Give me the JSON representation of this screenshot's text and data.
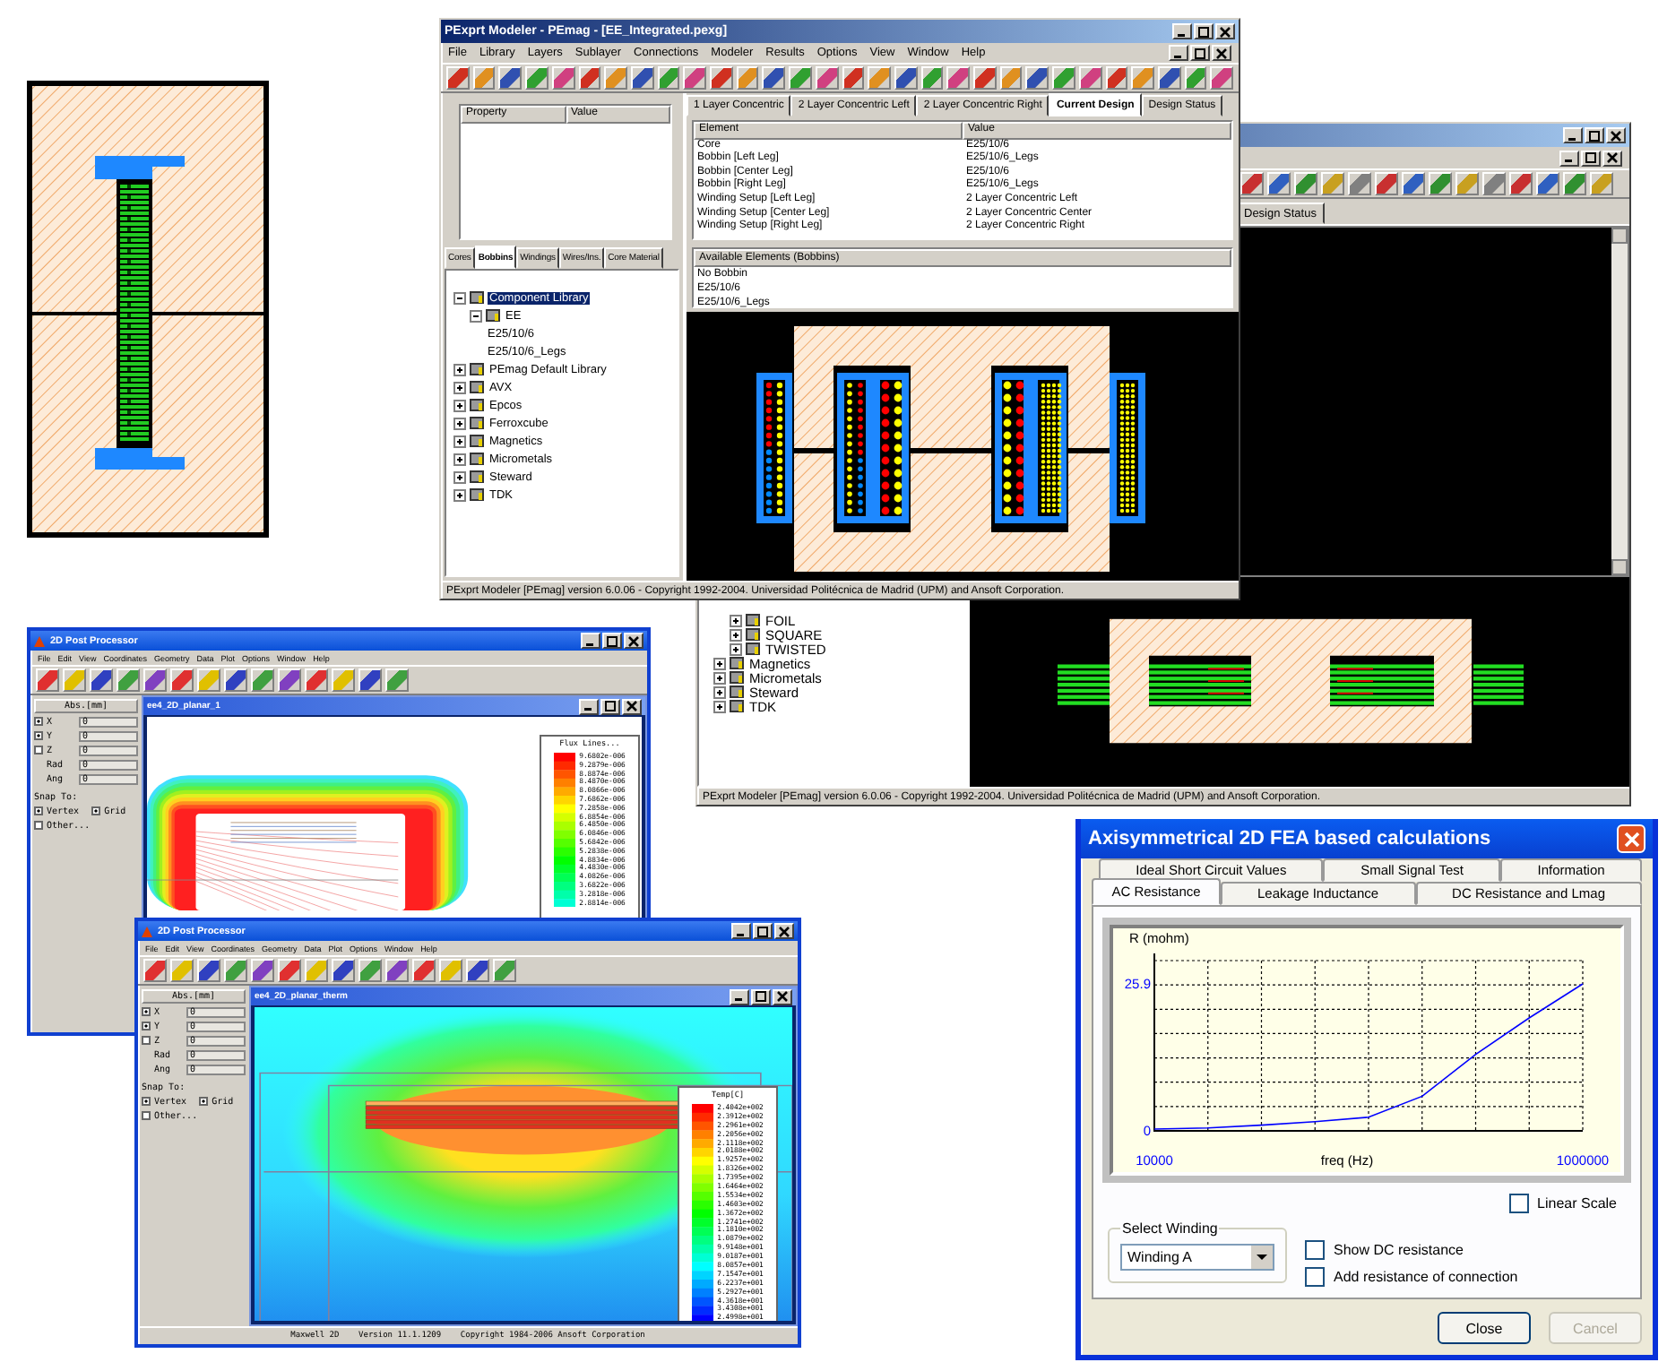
{
  "back_window": {
    "tabs": [
      {
        "label": "Design Status",
        "selected": false
      }
    ],
    "tree": [
      {
        "children": [
          {
            "label": "FOIL",
            "expanded": false,
            "selected": false
          },
          {
            "label": "SQUARE",
            "expanded": false,
            "selected": false
          },
          {
            "label": "TWISTED",
            "expanded": false,
            "selected": false
          }
        ]
      },
      {
        "label": "Magnetics",
        "expanded": false,
        "selected": false
      },
      {
        "label": "Micrometals",
        "expanded": false,
        "selected": false
      },
      {
        "label": "Steward",
        "expanded": false,
        "selected": false
      },
      {
        "label": "TDK",
        "expanded": false,
        "selected": false
      }
    ],
    "status_bar": "PExprt Modeler [PEmag] version 6.0.06 - Copyright 1992-2004. Universidad Politécnica de Madrid (UPM) and Ansoft Corporation."
  },
  "main_window": {
    "title": "PExprt Modeler - PEmag - [EE_Integrated.pexg]",
    "menu": [
      "File",
      "Library",
      "Layers",
      "Sublayer",
      "Connections",
      "Modeler",
      "Results",
      "Options",
      "View",
      "Window",
      "Help"
    ],
    "property_table": {
      "columns": [
        "Property",
        "Value"
      ]
    },
    "library_tabs": [
      {
        "label": "Cores",
        "selected": false
      },
      {
        "label": "Bobbins",
        "selected": true
      },
      {
        "label": "Windings",
        "selected": false
      },
      {
        "label": "Wires/Ins.",
        "selected": false
      },
      {
        "label": "Core Material",
        "selected": false
      }
    ],
    "tree": [
      {
        "label": "Component Library",
        "expanded": true,
        "selected": true,
        "children": [
          {
            "label": "EE",
            "expanded": true,
            "selected": false,
            "children": [
              {
                "label": "E25/10/6",
                "selected": false
              },
              {
                "label": "E25/10/6_Legs",
                "selected": false
              }
            ]
          }
        ]
      },
      {
        "label": "PEmag Default Library",
        "expanded": false,
        "selected": false
      },
      {
        "label": "AVX",
        "expanded": false,
        "selected": false
      },
      {
        "label": "Epcos",
        "expanded": false,
        "selected": false
      },
      {
        "label": "Ferroxcube",
        "expanded": false,
        "selected": false
      },
      {
        "label": "Magnetics",
        "expanded": false,
        "selected": false
      },
      {
        "label": "Micrometals",
        "expanded": false,
        "selected": false
      },
      {
        "label": "Steward",
        "expanded": false,
        "selected": false
      },
      {
        "label": "TDK",
        "expanded": false,
        "selected": false
      }
    ],
    "design_tabs": [
      {
        "label": "1 Layer Concentric",
        "selected": false
      },
      {
        "label": "2 Layer Concentric Left",
        "selected": false
      },
      {
        "label": "2 Layer Concentric Right",
        "selected": false
      },
      {
        "label": "Current Design",
        "selected": true
      },
      {
        "label": "Design Status",
        "selected": false
      }
    ],
    "element_table": {
      "columns": [
        "Element",
        "Value"
      ],
      "rows": [
        [
          "Core",
          "E25/10/6"
        ],
        [
          "Bobbin [Left Leg]",
          "E25/10/6_Legs"
        ],
        [
          "Bobbin [Center Leg]",
          "E25/10/6"
        ],
        [
          "Bobbin [Right Leg]",
          "E25/10/6_Legs"
        ],
        [
          "Winding Setup [Left Leg]",
          "2 Layer Concentric Left"
        ],
        [
          "Winding Setup [Center Leg]",
          "2 Layer Concentric Center"
        ],
        [
          "Winding Setup [Right Leg]",
          "2 Layer Concentric Right"
        ]
      ]
    },
    "available": {
      "title": "Available Elements (Bobbins)",
      "items": [
        "No Bobbin",
        "E25/10/6",
        "E25/10/6_Legs"
      ]
    },
    "status_bar": "PExprt Modeler [PEmag] version 6.0.06 - Copyright 1992-2004. Universidad Politécnica de Madrid (UPM) and Ansoft Corporation."
  },
  "flux_window": {
    "title": "2D Post Processor",
    "menu": [
      "File",
      "Edit",
      "View",
      "Coordinates",
      "Geometry",
      "Data",
      "Plot",
      "Options",
      "Window",
      "Help"
    ],
    "units": "Abs.[mm]",
    "fields": [
      {
        "label": "X",
        "checked": true,
        "value": "0"
      },
      {
        "label": "Y",
        "checked": true,
        "value": "0"
      },
      {
        "label": "Z",
        "checked": false,
        "value": "0"
      },
      {
        "label": "Rad",
        "value": "0"
      },
      {
        "label": "Ang",
        "value": "0"
      }
    ],
    "snap_label": "Snap To:",
    "snap_options": [
      {
        "label": "Vertex",
        "checked": true
      },
      {
        "label": "Grid",
        "checked": true
      },
      {
        "label": "Other...",
        "checked": false
      }
    ],
    "document_title": "ee4_2D_planar_1",
    "kind": "flux",
    "legend": {
      "title": "Flux Lines...",
      "values": [
        "9.6802e-006",
        "9.2879e-006",
        "8.8874e-006",
        "8.4870e-006",
        "8.0866e-006",
        "7.6862e-006",
        "7.2858e-006",
        "6.8854e-006",
        "6.4850e-006",
        "6.0846e-006",
        "5.6842e-006",
        "5.2838e-006",
        "4.8834e-006",
        "4.4830e-006",
        "4.0826e-006",
        "3.6822e-006",
        "3.2818e-006",
        "2.8814e-006"
      ]
    }
  },
  "temp_window": {
    "title": "2D Post Processor",
    "menu": [
      "File",
      "Edit",
      "View",
      "Coordinates",
      "Geometry",
      "Data",
      "Plot",
      "Options",
      "Window",
      "Help"
    ],
    "units": "Abs.[mm]",
    "fields": [
      {
        "label": "X",
        "checked": true,
        "value": "0"
      },
      {
        "label": "Y",
        "checked": true,
        "value": "0"
      },
      {
        "label": "Z",
        "checked": false,
        "value": "0"
      },
      {
        "label": "Rad",
        "value": "0"
      },
      {
        "label": "Ang",
        "value": "0"
      }
    ],
    "snap_label": "Snap To:",
    "snap_options": [
      {
        "label": "Vertex",
        "checked": true
      },
      {
        "label": "Grid",
        "checked": true
      },
      {
        "label": "Other...",
        "checked": false
      }
    ],
    "document_title": "ee4_2D_planar_therm",
    "kind": "temperature",
    "legend": {
      "title": "Temp[C]",
      "values": [
        "2.4042e+002",
        "2.3912e+002",
        "2.2961e+002",
        "2.2056e+002",
        "2.1118e+002",
        "2.0188e+002",
        "1.9257e+002",
        "1.8326e+002",
        "1.7395e+002",
        "1.6464e+002",
        "1.5534e+002",
        "1.4603e+002",
        "1.3672e+002",
        "1.2741e+002",
        "1.1810e+002",
        "1.0879e+002",
        "9.9148e+001",
        "9.0187e+001",
        "8.0857e+001",
        "7.1547e+001",
        "6.2237e+001",
        "5.2927e+001",
        "4.3618e+001",
        "3.4308e+001",
        "2.4998e+001"
      ]
    },
    "status_bar": "Maxwell 2D    Version 11.1.1209    Copyright 1984-2006 Ansoft Corporation"
  },
  "dialog": {
    "title": "Axisymmetrical 2D FEA based calculations",
    "tab_rows": [
      [
        {
          "label": "Ideal Short Circuit Values",
          "selected": false
        },
        {
          "label": "Small Signal Test",
          "selected": false
        },
        {
          "label": "Information",
          "selected": false
        }
      ],
      [
        {
          "label": "AC Resistance",
          "selected": true
        },
        {
          "label": "Leakage Inductance",
          "selected": false
        },
        {
          "label": "DC Resistance and Lmag",
          "selected": false
        }
      ]
    ],
    "chart_data": {
      "type": "line",
      "xlabel": "freq (Hz)",
      "ylabel": "R (mohm)",
      "categories": [
        "10000",
        null,
        null,
        null,
        null,
        null,
        null,
        null,
        "1000000"
      ],
      "series": [
        {
          "color": "#0000ff",
          "values": [
            0.3,
            0.5,
            1.0,
            1.6,
            2.4,
            6.1,
            13.5,
            19.9,
            25.9
          ]
        }
      ],
      "ylim": [
        0,
        30
      ],
      "yticks": [
        0,
        25.9
      ],
      "grid": true
    },
    "linear_scale": {
      "label": "Linear Scale",
      "checked": false
    },
    "winding_group": {
      "title": "Select Winding",
      "value": "Winding A"
    },
    "options": [
      {
        "label": "Show DC resistance",
        "checked": false
      },
      {
        "label": "Add resistance of connection",
        "checked": false
      }
    ],
    "buttons": [
      {
        "label": "Close",
        "disabled": false
      },
      {
        "label": "Cancel",
        "disabled": true
      }
    ]
  }
}
